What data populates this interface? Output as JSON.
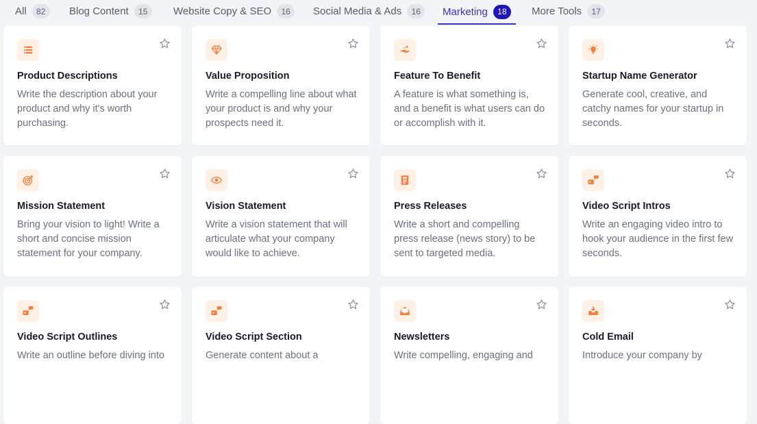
{
  "tabs": [
    {
      "label": "All",
      "count": "82",
      "active": false
    },
    {
      "label": "Blog Content",
      "count": "15",
      "active": false
    },
    {
      "label": "Website Copy & SEO",
      "count": "16",
      "active": false
    },
    {
      "label": "Social Media & Ads",
      "count": "16",
      "active": false
    },
    {
      "label": "Marketing",
      "count": "18",
      "active": true
    },
    {
      "label": "More Tools",
      "count": "17",
      "active": false
    }
  ],
  "colors": {
    "accent": "#3b2fc9",
    "active_badge": "#1f17b8",
    "icon_orange": "#f47c3c",
    "icon_bg": "#fff1e6",
    "star": "#8a93a8"
  },
  "cards": [
    {
      "icon": "list-icon",
      "title": "Product Descriptions",
      "desc": "Write the description about your product and why it's worth purchasing."
    },
    {
      "icon": "diamond-icon",
      "title": "Value Proposition",
      "desc": "Write a compelling line about what your product is and why your prospects need it."
    },
    {
      "icon": "hand-sparkle-icon",
      "title": "Feature To Benefit",
      "desc": "A feature is what something is, and a benefit is what users can do or accomplish with it."
    },
    {
      "icon": "lightbulb-icon",
      "title": "Startup Name Generator",
      "desc": "Generate cool, creative, and catchy names for your startup in seconds."
    },
    {
      "icon": "target-icon",
      "title": "Mission Statement",
      "desc": "Bring your vision to light! Write a short and concise mission statement for your company."
    },
    {
      "icon": "eye-icon",
      "title": "Vision Statement",
      "desc": "Write a vision statement that will articulate what your company would like to achieve."
    },
    {
      "icon": "newspaper-icon",
      "title": "Press Releases",
      "desc": "Write a short and compelling press release (news story) to be sent to targeted media."
    },
    {
      "icon": "video-chat-icon",
      "title": "Video Script Intros",
      "desc": "Write an engaging video intro to hook your audience in the first few seconds."
    },
    {
      "icon": "video-chat-icon",
      "title": "Video Script Outlines",
      "desc": "Write an outline before diving into"
    },
    {
      "icon": "video-chat-icon",
      "title": "Video Script Section",
      "desc": "Generate content about a"
    },
    {
      "icon": "mail-open-icon",
      "title": "Newsletters",
      "desc": "Write compelling, engaging and"
    },
    {
      "icon": "inbox-download-icon",
      "title": "Cold Email",
      "desc": "Introduce your company by"
    }
  ]
}
